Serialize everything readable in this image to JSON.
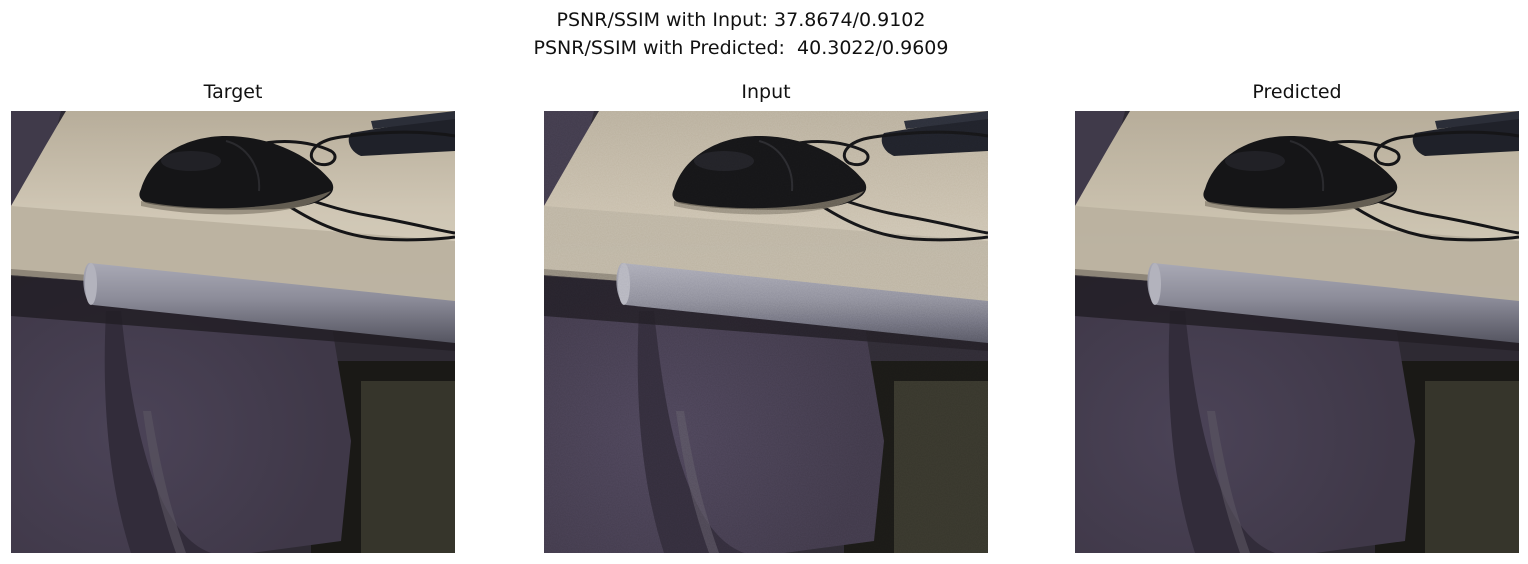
{
  "figure": {
    "suptitle_line1": "PSNR/SSIM with Input: 37.8674/0.9102",
    "suptitle_line2": "PSNR/SSIM with Predicted:  40.3022/0.9609"
  },
  "panels": [
    {
      "title": "Target",
      "variant": "clean"
    },
    {
      "title": "Input",
      "variant": "noisy"
    },
    {
      "title": "Predicted",
      "variant": "smooth"
    }
  ],
  "colors": {
    "chair_purple": "#3f3848",
    "desk_top": "#cfc6b4",
    "desk_edge": "#b9b09e",
    "pipe": "#8c8c99",
    "mouse": "#151517",
    "floor_dark": "#1a1916",
    "floor_olive": "#36352b"
  }
}
